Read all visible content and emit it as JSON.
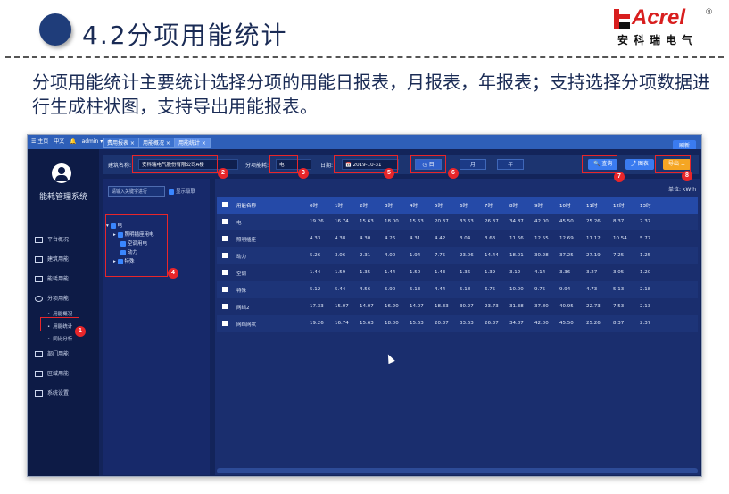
{
  "slide": {
    "title": "4.2分项用能统计",
    "description": "分项用能统计主要统计选择分项的用能日报表，月报表，年报表；支持选择分项数据进行生成柱状图，支持导出用能报表。",
    "logo_text": "Acrel",
    "logo_registered": "®",
    "logo_cn": "安科瑞电气",
    "accent_color": "#1f3d7a",
    "highlight_color": "#e8262a"
  },
  "app": {
    "topbar": {
      "home": "☰ 主页",
      "lang": "中文",
      "bell": "🔔",
      "user": "admin ▾"
    },
    "tabs": [
      "费用报表 ×",
      "用能概况 ×",
      "用能统计 ×"
    ],
    "top_right_button": "刷新",
    "system_name": "能耗管理系统",
    "menu": [
      {
        "label": "平台概况",
        "icon": "monitor-icon"
      },
      {
        "label": "建筑用能",
        "icon": "building-icon"
      },
      {
        "label": "能耗用能",
        "icon": "grid-icon"
      },
      {
        "label": "分项用能",
        "icon": "clock-icon"
      }
    ],
    "submenu": [
      "用能概况",
      "用能统计",
      "同比分析"
    ],
    "menu_bottom": [
      {
        "label": "部门用能",
        "icon": "folder-icon"
      },
      {
        "label": "区域用能",
        "icon": "area-icon"
      },
      {
        "label": "系统设置",
        "icon": "settings-icon"
      }
    ],
    "filter": {
      "building_label": "建筑名称:",
      "building_value": "安科瑞电气股份有限公司A楼",
      "category_label": "分项能耗:",
      "category_value": "电",
      "date_label": "日期:",
      "date_value": "📅 2019-10-31",
      "seg_day": "日",
      "seg_month": "月",
      "seg_year": "年",
      "query_button": "🔍 查询",
      "chart_button": "⤴ 图表",
      "export_button": "导出 ±"
    },
    "tree": {
      "search_placeholder": "请输入关键字进行",
      "expand_label": "显示级联",
      "items": [
        "电",
        "照明插座用电",
        "空调用电",
        "动力",
        "特殊"
      ]
    },
    "table": {
      "unit": "单位: kW·h",
      "headers": [
        "用能名称",
        "0时",
        "1时",
        "2时",
        "3时",
        "4时",
        "5时",
        "6时",
        "7时",
        "8时",
        "9时",
        "10时",
        "11时",
        "12时",
        "13时"
      ],
      "rows": [
        [
          "电",
          "19.26",
          "16.74",
          "15.63",
          "18.00",
          "15.63",
          "20.37",
          "33.63",
          "26.37",
          "34.87",
          "42.00",
          "45.50",
          "25.26",
          "8.37",
          "2.37"
        ],
        [
          "照明插座",
          "4.33",
          "4.38",
          "4.30",
          "4.26",
          "4.31",
          "4.42",
          "3.04",
          "3.63",
          "11.66",
          "12.55",
          "12.69",
          "11.12",
          "10.54",
          "5.77"
        ],
        [
          "动力",
          "5.26",
          "3.06",
          "2.31",
          "4.00",
          "1.94",
          "7.75",
          "23.06",
          "14.44",
          "18.01",
          "30.28",
          "37.25",
          "27.19",
          "7.25",
          "1.25"
        ],
        [
          "空调",
          "1.44",
          "1.59",
          "1.35",
          "1.44",
          "1.50",
          "1.43",
          "1.36",
          "1.39",
          "3.12",
          "4.14",
          "3.36",
          "3.27",
          "3.05",
          "1.20"
        ],
        [
          "特殊",
          "5.12",
          "5.44",
          "4.56",
          "5.90",
          "5.13",
          "4.44",
          "5.18",
          "6.75",
          "10.00",
          "9.75",
          "9.94",
          "4.73",
          "5.13",
          "2.18"
        ],
        [
          "网络2",
          "17.33",
          "15.07",
          "14.07",
          "16.20",
          "14.07",
          "18.33",
          "30.27",
          "23.73",
          "31.38",
          "37.80",
          "40.95",
          "22.73",
          "7.53",
          "2.13"
        ],
        [
          "网络网状",
          "19.26",
          "16.74",
          "15.63",
          "18.00",
          "15.63",
          "20.37",
          "33.63",
          "26.37",
          "34.87",
          "42.00",
          "45.50",
          "25.26",
          "8.37",
          "2.37"
        ]
      ]
    },
    "badges": [
      "1",
      "2",
      "3",
      "4",
      "5",
      "6",
      "7",
      "8"
    ]
  }
}
